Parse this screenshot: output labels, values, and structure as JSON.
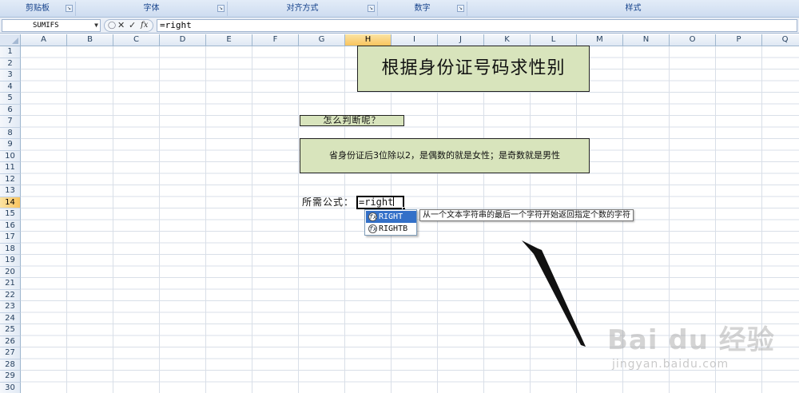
{
  "ribbon": {
    "groups": [
      {
        "label": "剪贴板"
      },
      {
        "label": "字体"
      },
      {
        "label": "对齐方式"
      },
      {
        "label": "数字"
      },
      {
        "label": "样式"
      }
    ]
  },
  "formula_bar": {
    "name_box": "SUMIFS",
    "cancel_glyph": "✕",
    "enter_glyph": "✓",
    "fx_glyph": "fx",
    "formula": "=right"
  },
  "columns": [
    "A",
    "B",
    "C",
    "D",
    "E",
    "F",
    "G",
    "H",
    "I",
    "J",
    "K",
    "L",
    "M",
    "N",
    "O",
    "P",
    "Q"
  ],
  "active_column": "H",
  "rows": [
    "1",
    "2",
    "3",
    "4",
    "5",
    "6",
    "7",
    "8",
    "9",
    "10",
    "11",
    "12",
    "13",
    "14",
    "15",
    "16",
    "17",
    "18",
    "19",
    "20",
    "21",
    "22",
    "23",
    "24",
    "25",
    "26",
    "27",
    "28",
    "29",
    "30"
  ],
  "active_row": "14",
  "sheet": {
    "title": "根据身份证号码求性别",
    "question": "怎么判断呢？",
    "explanation": "省身份证后3位除以2，是偶数的就是女性；是奇数就是男性",
    "formula_label": "所需公式：",
    "active_cell_text": "=right"
  },
  "autocomplete": {
    "items": [
      {
        "label": "RIGHT",
        "selected": true
      },
      {
        "label": "RIGHTB",
        "selected": false
      }
    ],
    "tooltip": "从一个文本字符串的最后一个字符开始返回指定个数的字符"
  },
  "watermark": {
    "brand": "Bai du 经验",
    "url": "jingyan.baidu.com"
  },
  "colors": {
    "box_fill": "#d8e4bc",
    "selected_item": "#3370c8",
    "active_header": "#f9c45e"
  }
}
